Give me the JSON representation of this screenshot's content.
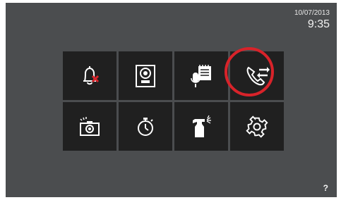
{
  "status": {
    "date": "10/07/2013",
    "time": "9:35"
  },
  "menu": {
    "tiles": [
      {
        "id": "bell-mute",
        "icon": "bell-muted-icon"
      },
      {
        "id": "intercom",
        "icon": "intercom-panel-icon"
      },
      {
        "id": "voice-memo",
        "icon": "microphone-notepad-icon"
      },
      {
        "id": "call-transfer",
        "icon": "phone-transfer-icon",
        "highlighted": true
      },
      {
        "id": "photos",
        "icon": "camera-icon"
      },
      {
        "id": "timer",
        "icon": "stopwatch-icon"
      },
      {
        "id": "cleaning",
        "icon": "spray-bottle-icon"
      },
      {
        "id": "settings",
        "icon": "gear-icon"
      }
    ]
  },
  "help": {
    "label": "?"
  },
  "colors": {
    "background": "#4b4d4f",
    "tile": "#202020",
    "icon": "#ffffff",
    "mute_x": "#d8232a",
    "highlight_ring": "#d8232a"
  }
}
